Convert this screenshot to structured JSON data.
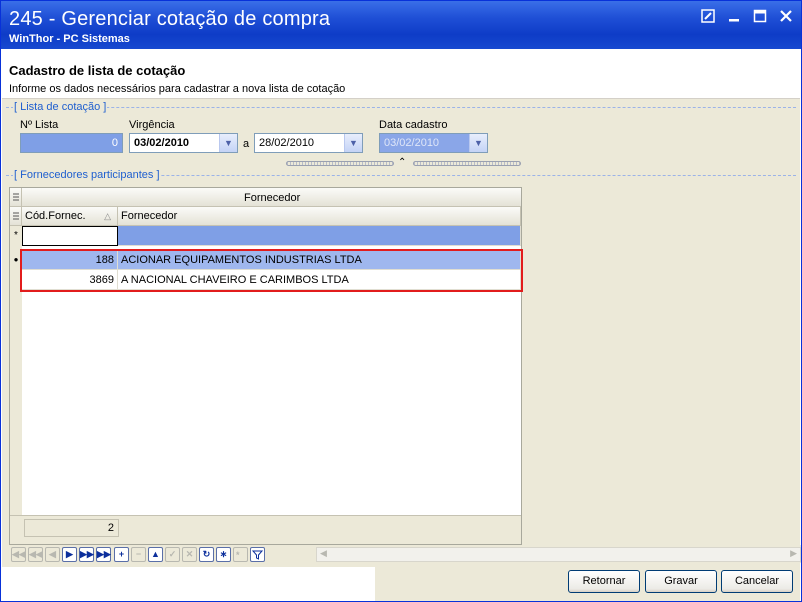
{
  "window": {
    "title": "245 - Gerenciar cotação de compra",
    "subtitle": "WinThor - PC Sistemas"
  },
  "header": {
    "title": "Cadastro de lista de cotação",
    "description": "Informe os dados necessários para cadastrar a nova lista de cotação"
  },
  "lista_group": {
    "label": "[ Lista de cotação ]",
    "numero_label": "Nº Lista",
    "numero_value": "0",
    "vigencia_label": "Virgência",
    "vigencia_from": "03/02/2010",
    "vigencia_sep": "a",
    "vigencia_to": "28/02/2010",
    "data_cadastro_label": "Data cadastro",
    "data_cadastro_value": "03/02/2010"
  },
  "fornecedores_group": {
    "label": "[ Fornecedores participantes ]",
    "band_header": "Fornecedor",
    "columns": [
      "Cód.Fornec.",
      "Fornecedor"
    ],
    "rows": [
      {
        "codigo": "188",
        "nome": "ACIONAR EQUIPAMENTOS INDUSTRIAS LTDA"
      },
      {
        "codigo": "3869",
        "nome": "A NACIONAL CHAVEIRO E CARIMBOS LTDA"
      }
    ],
    "count": "2"
  },
  "navigator": {
    "first": "◀◀",
    "prior_page": "◀◀",
    "prior": "◀",
    "next": "▶",
    "next_page": "▶▶",
    "last": "▶▶",
    "insert": "+",
    "delete": "−",
    "edit": "▲",
    "post": "✓",
    "cancel": "✕",
    "refresh": "↻",
    "filter": "∗"
  },
  "buttons": {
    "retornar": "Retornar",
    "gravar": "Gravar",
    "cancelar": "Cancelar"
  }
}
